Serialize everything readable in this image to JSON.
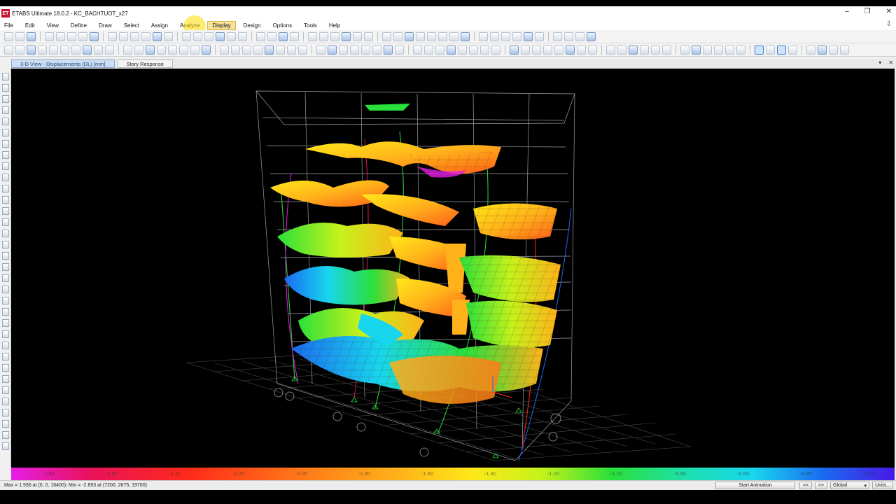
{
  "window": {
    "app_logo": "ET",
    "title": "ETABS Ultimate 18.0.2 - KC_BACHTUOT_x27",
    "controls": [
      "–",
      "❐",
      "✕"
    ]
  },
  "menu": {
    "items": [
      "File",
      "Edit",
      "View",
      "Define",
      "Draw",
      "Select",
      "Assign",
      "Analyze",
      "Display",
      "Design",
      "Options",
      "Tools",
      "Help"
    ],
    "active": "Display"
  },
  "tabs": {
    "view": "3-D View  -  Displacements (DL)  [mm]",
    "story_response": "Story Response"
  },
  "legend": {
    "labels": [
      "-2.80",
      "-2.60",
      "-2.40",
      "-2.20",
      "-2.00",
      "-1.80",
      "-1.60",
      "-1.40",
      "-1.20",
      "-1.00",
      "-0.80",
      "-0.60",
      "-0.40",
      "-0.20"
    ]
  },
  "status": {
    "text": "Max = 1.936 at (0, 0, 16400);  Min = -2.893 at (7200, 2675, 19700)",
    "animation_button": "Start Animation",
    "prev_button": "<<",
    "next_button": ">>",
    "coord_system": "Global",
    "units_button": "Units..."
  },
  "colors": {
    "viewport_bg": "#000000",
    "active_menu_bg": "#f6e29a",
    "app_logo": "#c8102e"
  }
}
